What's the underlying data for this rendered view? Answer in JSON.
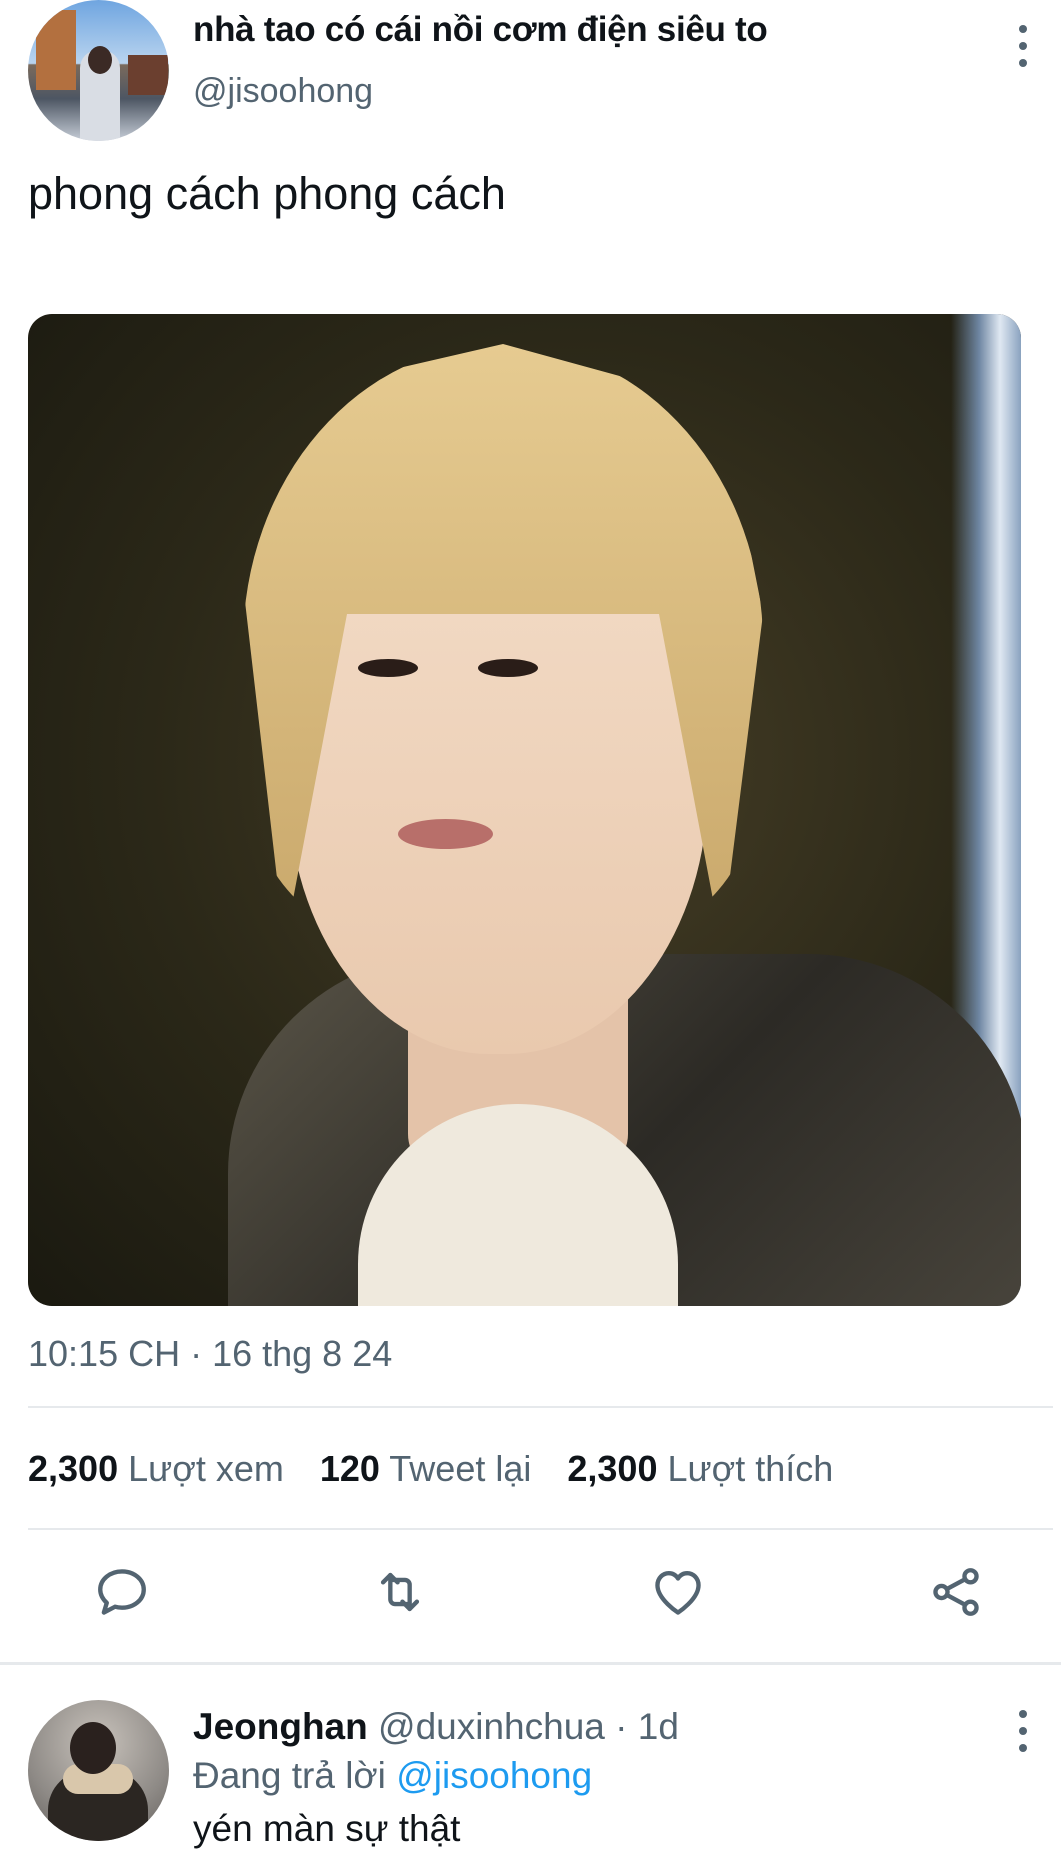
{
  "tweet": {
    "display_name": "nhà tao có cái nồi cơm điện siêu to",
    "handle": "@jisoohong",
    "text": "phong cách phong cách",
    "timestamp": "10:15 CH · 16 thg 8 24",
    "stats": [
      {
        "value": "2,300",
        "label": "Lượt xem"
      },
      {
        "value": "120",
        "label": "Tweet lại"
      },
      {
        "value": "2,300",
        "label": "Lượt thích"
      }
    ],
    "actions": [
      "reply-icon",
      "retweet-icon",
      "like-icon",
      "share-icon"
    ]
  },
  "reply": {
    "display_name": "Jeonghan",
    "handle_time": "@duxinhchua · 1d",
    "replying_prefix": "Đang trả lời ",
    "replying_to": "@jisoohong",
    "text": "yén màn sự thật"
  },
  "colors": {
    "text_primary": "#0f1419",
    "text_secondary": "#536471",
    "link": "#1d9bf0",
    "divider": "#e6e9ec"
  }
}
